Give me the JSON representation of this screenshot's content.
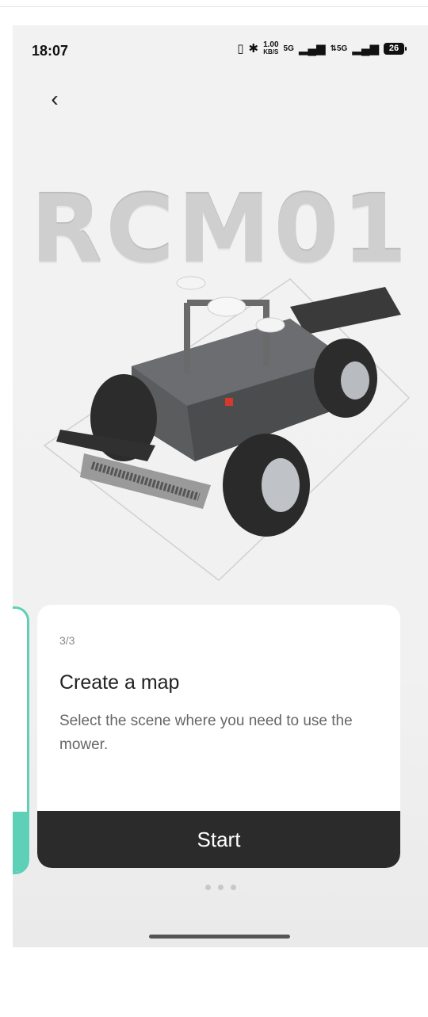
{
  "status_bar": {
    "time": "18:07",
    "speed_value": "1.00",
    "speed_unit": "KB/S",
    "signal1_label": "5G",
    "signal2_label": "⇅5G",
    "battery": "26"
  },
  "hero": {
    "product_name": "RCM01"
  },
  "card": {
    "step": "3/3",
    "title": "Create a map",
    "description": "Select the scene where you need to use the mower.",
    "start_label": "Start"
  },
  "colors": {
    "accent": "#5fd0b8",
    "button": "#2b2b2b"
  },
  "icons": {
    "back": "chevron-left-icon",
    "vibrate": "vibrate-icon",
    "bluetooth": "bluetooth-icon"
  },
  "pager": {
    "total": 3
  }
}
